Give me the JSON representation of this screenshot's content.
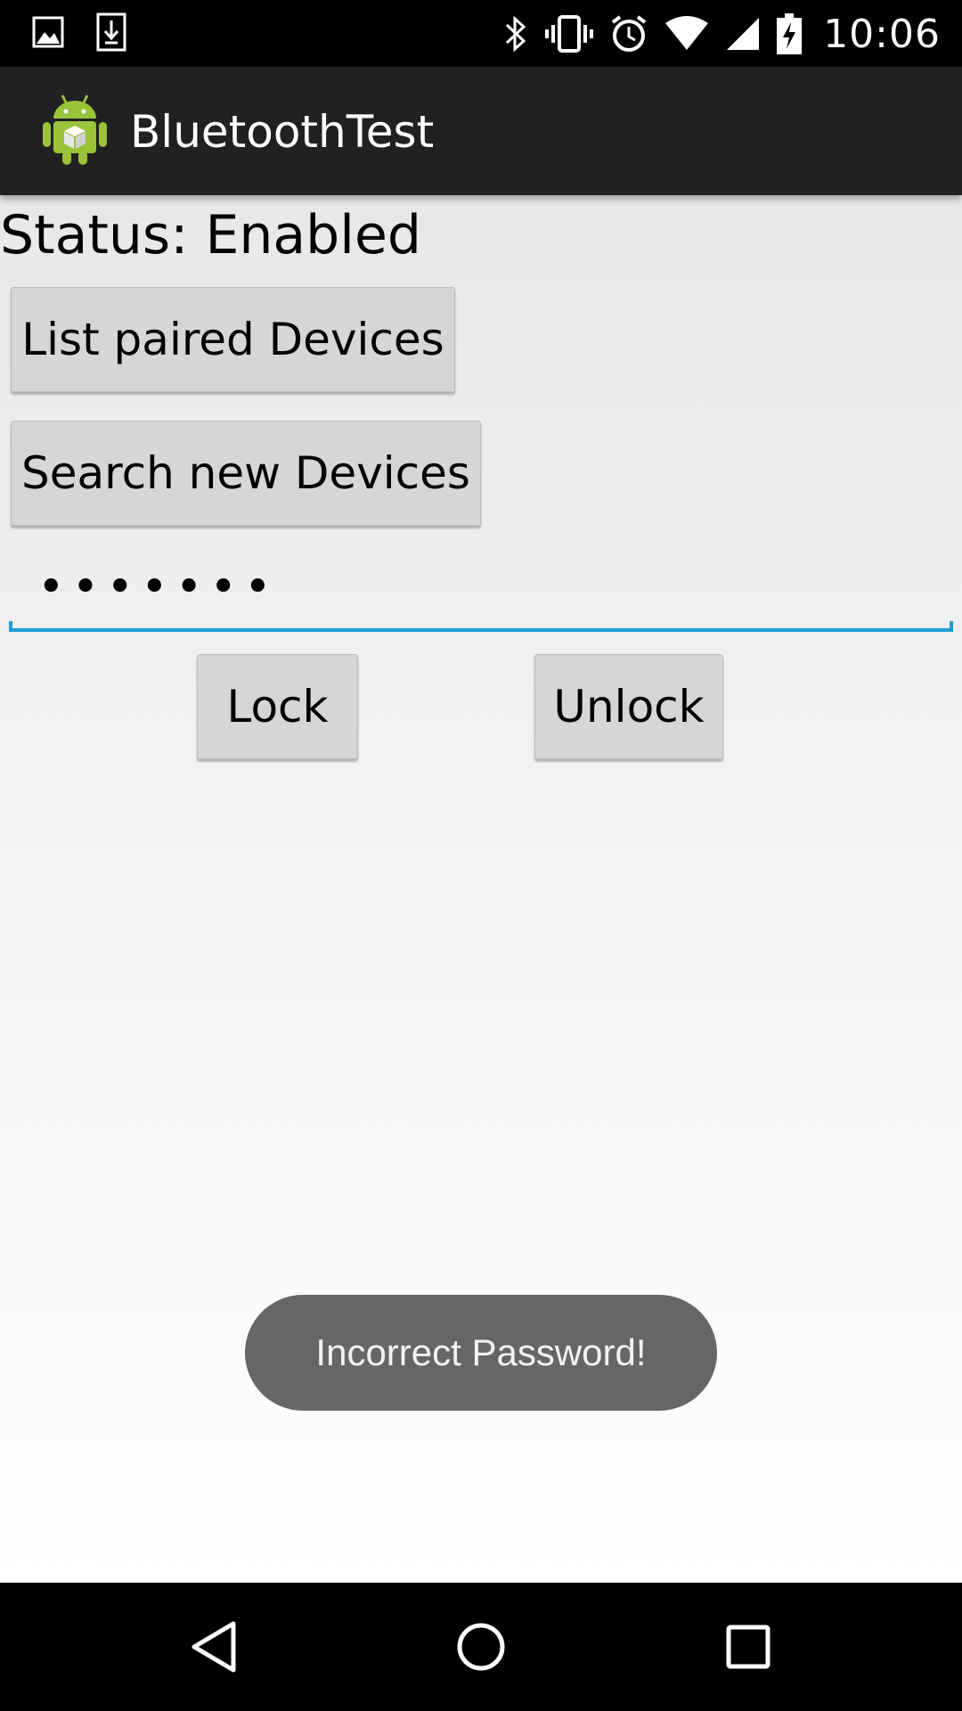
{
  "status_bar": {
    "left_icons": [
      "image-icon",
      "download-icon"
    ],
    "right_icons": [
      "bluetooth-icon",
      "vibrate-icon",
      "alarm-icon",
      "wifi-icon",
      "signal-icon",
      "battery-charging-icon"
    ],
    "time": "10:06"
  },
  "action_bar": {
    "app_icon": "android-robot-icon",
    "title": "BluetoothTest"
  },
  "main": {
    "status_label": "Status: Enabled",
    "list_paired_button": "List paired Devices",
    "search_new_button": "Search new Devices",
    "password_value": "•••••••",
    "lock_button": "Lock",
    "unlock_button": "Unlock"
  },
  "toast": {
    "message": "Incorrect Password!"
  },
  "nav_bar": {
    "icons": [
      "back-icon",
      "home-icon",
      "recents-icon"
    ]
  },
  "colors": {
    "accent": "#1e9ed6",
    "action_bar": "#212121",
    "button": "#d6d6d6",
    "toast": "#666666"
  }
}
